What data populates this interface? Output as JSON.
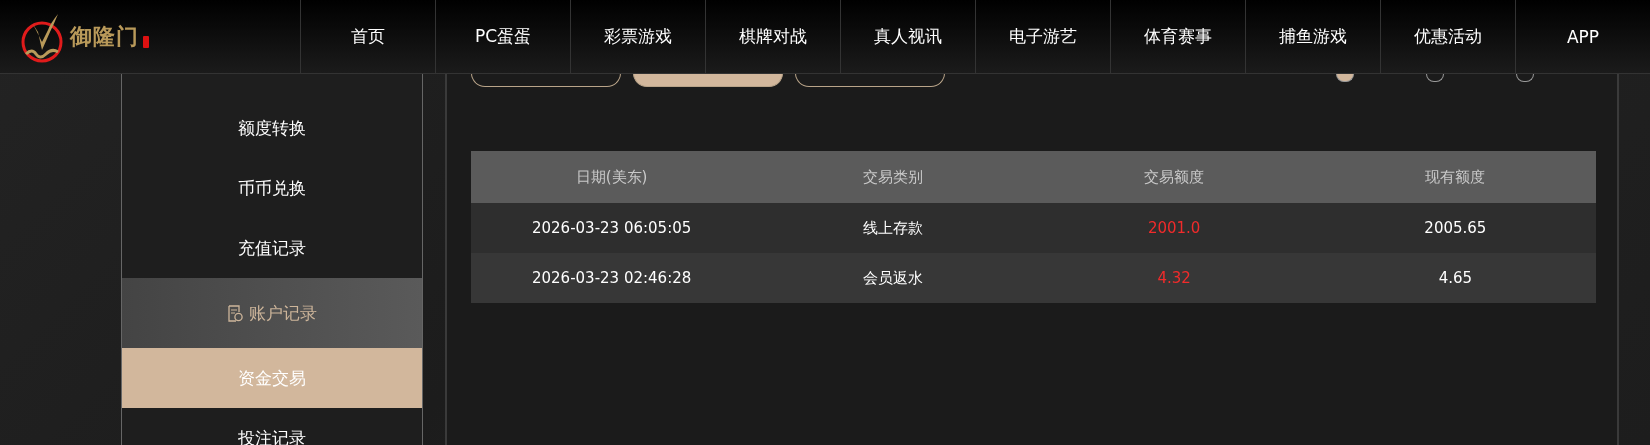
{
  "logo": {
    "text": "御隆门"
  },
  "nav": [
    {
      "label": "首页"
    },
    {
      "label": "PC蛋蛋"
    },
    {
      "label": "彩票游戏"
    },
    {
      "label": "棋牌对战"
    },
    {
      "label": "真人视讯"
    },
    {
      "label": "电子游艺"
    },
    {
      "label": "体育赛事"
    },
    {
      "label": "捕鱼游戏"
    },
    {
      "label": "优惠活动"
    },
    {
      "label": "APP"
    }
  ],
  "sidebar": {
    "items": [
      {
        "label": "额度转换",
        "kind": "item",
        "selected": false
      },
      {
        "label": "币币兑换",
        "kind": "item",
        "selected": false
      },
      {
        "label": "充值记录",
        "kind": "item",
        "selected": false
      },
      {
        "label": "账户记录",
        "kind": "group",
        "selected": false
      },
      {
        "label": "资金交易",
        "kind": "item",
        "selected": true
      },
      {
        "label": "投注记录",
        "kind": "item",
        "selected": false
      }
    ]
  },
  "filter_buttons": [
    {
      "selected": false
    },
    {
      "selected": true
    },
    {
      "selected": false
    }
  ],
  "period_radios": [
    {
      "selected": true
    },
    {
      "selected": false
    },
    {
      "selected": false
    }
  ],
  "table": {
    "columns": [
      "日期(美东)",
      "交易类别",
      "交易额度",
      "现有额度"
    ],
    "rows": [
      [
        "2026-03-23 06:05:05",
        "线上存款",
        "2001.0",
        "2005.65"
      ],
      [
        "2026-03-23 02:46:28",
        "会员返水",
        "4.32",
        "4.65"
      ]
    ]
  }
}
